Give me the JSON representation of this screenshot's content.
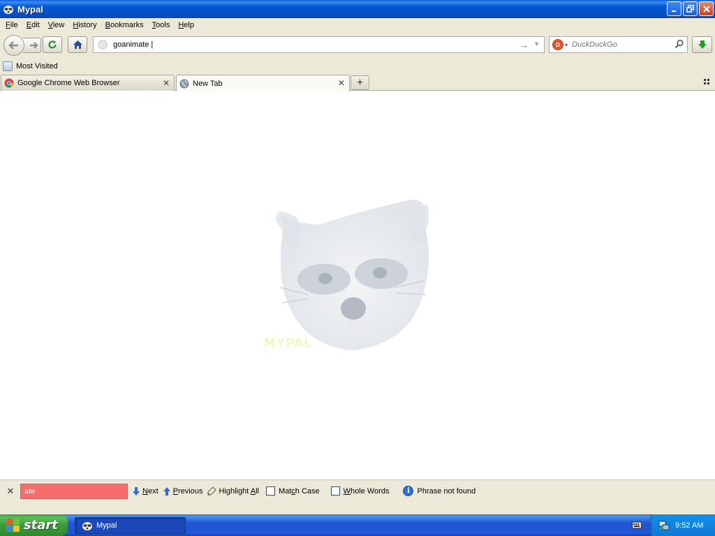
{
  "window": {
    "title": "Mypal"
  },
  "menu": {
    "items": [
      {
        "label": "File",
        "key": "F",
        "rest": "ile"
      },
      {
        "label": "Edit",
        "key": "E",
        "rest": "dit"
      },
      {
        "label": "View",
        "key": "V",
        "rest": "iew"
      },
      {
        "label": "History",
        "key": "H",
        "rest": "istory"
      },
      {
        "label": "Bookmarks",
        "key": "B",
        "rest": "ookmarks"
      },
      {
        "label": "Tools",
        "key": "T",
        "rest": "ools"
      },
      {
        "label": "Help",
        "key": "H",
        "rest": "elp"
      }
    ]
  },
  "navbar": {
    "url_value": "goanimate |",
    "search_placeholder": "DuckDuckGo"
  },
  "bookmarks": {
    "most_visited": "Most Visited"
  },
  "tabs": [
    {
      "label": "Google Chrome Web Browser",
      "active": false
    },
    {
      "label": "New Tab",
      "active": true
    }
  ],
  "content": {
    "watermark": "MYPAL"
  },
  "findbar": {
    "query": "ate",
    "next_key": "N",
    "next_rest": "ext",
    "prev_key": "P",
    "prev_rest": "revious",
    "highlight_pre": "Highlight ",
    "highlight_key": "A",
    "highlight_rest": "ll",
    "matchcase_pre": "Mat",
    "matchcase_key": "c",
    "matchcase_rest": "h Case",
    "wholewords_key": "W",
    "wholewords_rest": "hole Words",
    "status": "Phrase not found",
    "field_color": "#f66d6d"
  },
  "taskbar": {
    "start_label": "start",
    "task_label": "Mypal",
    "clock": "9:52 AM"
  }
}
